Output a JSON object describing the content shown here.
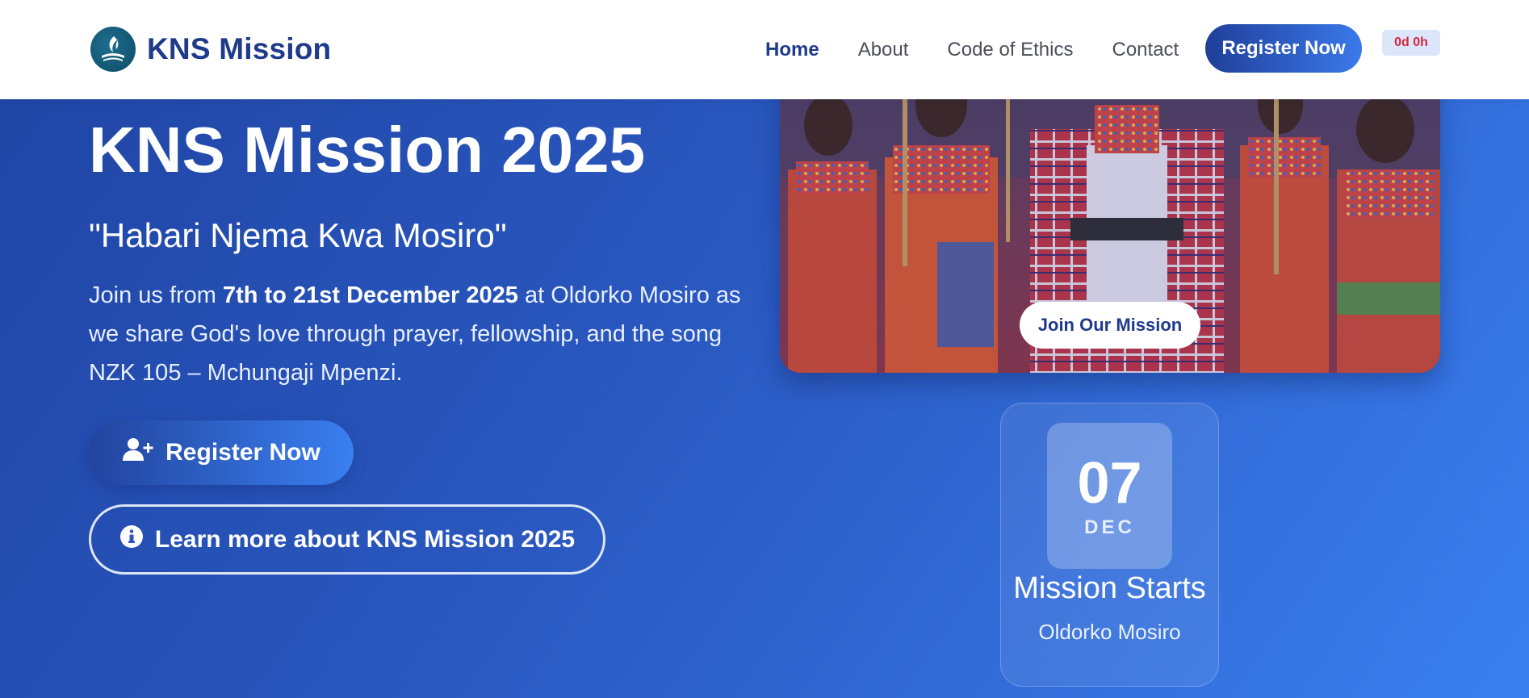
{
  "nav": {
    "brand": "KNS Mission",
    "links": [
      "Home",
      "About",
      "Code of Ethics",
      "Contact"
    ],
    "register_label": "Register Now",
    "countdown": "0d 0h"
  },
  "hero": {
    "title": "KNS Mission 2025",
    "tagline": "\"Habari Njema Kwa Mosiro\"",
    "desc_prefix": "Join us from ",
    "desc_dates": "7th to 21st December 2025",
    "desc_suffix": " at Oldorko Mosiro as we share God's love through prayer, fellowship, and the song NZK 105 – Mchungaji Mpenzi.",
    "register_label": "Register Now",
    "learn_label": "Learn more about KNS Mission 2025"
  },
  "image_card": {
    "button_label": "Join Our Mission"
  },
  "date_card": {
    "day": "07",
    "month": "DEC",
    "title": "Mission Starts",
    "place": "Oldorko Mosiro"
  },
  "colors": {
    "brand": "#1e3a8a",
    "accent": "#3a7ff0",
    "countdown_text": "#d8263a"
  },
  "icons": [
    "sda-logo-icon",
    "user-plus-icon",
    "info-circle-icon"
  ]
}
